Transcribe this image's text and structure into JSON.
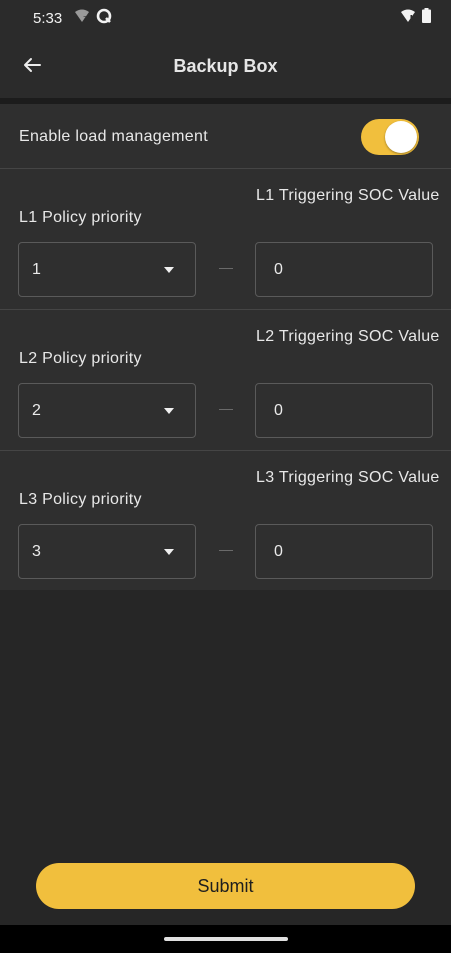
{
  "status_bar": {
    "time": "5:33",
    "icons_left": [
      "wifi-question-icon",
      "q-app-icon"
    ],
    "icons_right": [
      "wifi-alert-icon",
      "battery-icon"
    ]
  },
  "app_bar": {
    "title": "Backup Box",
    "back_icon": "arrow-left-icon"
  },
  "load_management": {
    "label": "Enable load management",
    "enabled": true
  },
  "levels": [
    {
      "policy_label": "L1 Policy priority",
      "policy_value": "1",
      "soc_label": "L1 Triggering SOC Value",
      "soc_value": "0"
    },
    {
      "policy_label": "L2 Policy priority",
      "policy_value": "2",
      "soc_label": "L2 Triggering SOC Value",
      "soc_value": "0"
    },
    {
      "policy_label": "L3 Policy priority",
      "policy_value": "3",
      "soc_label": "L3 Triggering SOC Value",
      "soc_value": "0"
    }
  ],
  "submit_label": "Submit",
  "colors": {
    "accent": "#f1bf3d",
    "background": "#262626",
    "panel": "#2f2f2f"
  }
}
